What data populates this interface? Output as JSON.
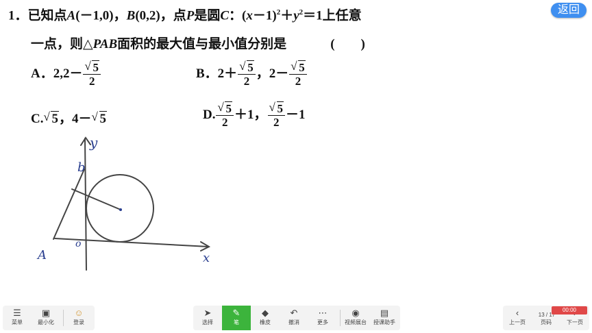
{
  "question": {
    "number": "1．",
    "line1": {
      "t1": "已知点",
      "A": "A",
      "Acoord": "(－1,0)，",
      "B": "B",
      "Bcoord": "(0,2)，点",
      "P": "P",
      "t2": "是圆",
      "C": "C",
      "t3": "：(",
      "x": "x",
      "t4": "－1)",
      "sq": "2",
      "plus": "＋",
      "y": "y",
      "sq2": "2",
      "t5": "＝1上任意"
    },
    "line2": {
      "t1": "一点，则△",
      "PAB": "PAB",
      "t2": "面积的最大值与最小值分别是",
      "paren": "(　　)"
    },
    "optA": {
      "label": "A．2,2－",
      "num": "5",
      "den": "2"
    },
    "optB": {
      "label": "B．2＋",
      "num1": "5",
      "den1": "2",
      "mid": "，2－",
      "num2": "5",
      "den2": "2"
    },
    "optC": {
      "label": "C.",
      "r1": "5",
      "mid": "，4－",
      "r2": "5"
    },
    "optD": {
      "label": "D.",
      "num1": "5",
      "den1": "2",
      "mid": "＋1，",
      "num2": "5",
      "den2": "2",
      "end": "－1"
    }
  },
  "back_button": "返回",
  "handwriting": {
    "y_label": "y",
    "x_label": "x",
    "b_label": "b",
    "a_label": "A",
    "o_label": "o"
  },
  "toolbar_left": [
    {
      "label": "菜单",
      "icon": "menu-icon"
    },
    {
      "label": "最小化",
      "icon": "minimize-icon"
    },
    {
      "label": "登录",
      "icon": "avatar-icon"
    }
  ],
  "toolbar_center": [
    {
      "label": "选择",
      "icon": "cursor-icon"
    },
    {
      "label": "笔",
      "icon": "pen-icon"
    },
    {
      "label": "橡皮",
      "icon": "eraser-icon"
    },
    {
      "label": "撤消",
      "icon": "undo-icon"
    },
    {
      "label": "更多",
      "icon": "more-icon"
    },
    {
      "label": "视频展台",
      "icon": "camera-icon"
    },
    {
      "label": "授课助手",
      "icon": "assistant-icon"
    }
  ],
  "toolbar_right": [
    {
      "label": "上一页",
      "icon": "chevron-left-icon"
    },
    {
      "label": "页码",
      "icon": "page-icon"
    },
    {
      "label": "下一页",
      "icon": "chevron-right-icon"
    }
  ],
  "page_counter": "13 / 17",
  "recording_time": "00:00",
  "colors": {
    "accent_green": "#3cb43c",
    "back_blue": "#3f8ff0",
    "ink": "#2a3f8f"
  }
}
